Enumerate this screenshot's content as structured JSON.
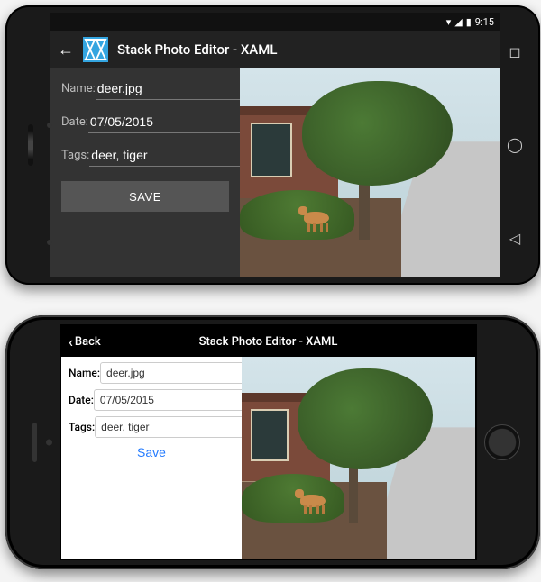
{
  "android": {
    "status": {
      "time": "9:15",
      "icons": [
        "wifi-icon",
        "signal-icon",
        "battery-icon"
      ]
    },
    "title": "Stack Photo Editor - XAML",
    "back_icon": "←",
    "form": {
      "name_label": "Name:",
      "name_value": "deer.jpg",
      "date_label": "Date:",
      "date_value": "07/05/2015",
      "tags_label": "Tags:",
      "tags_value": "deer, tiger",
      "save_label": "SAVE"
    },
    "nav": {
      "recents": "◻",
      "home": "◯",
      "back": "◁"
    }
  },
  "ios": {
    "back_label": "Back",
    "title": "Stack Photo Editor - XAML",
    "form": {
      "name_label": "Name:",
      "name_value": "deer.jpg",
      "date_label": "Date:",
      "date_value": "07/05/2015",
      "tags_label": "Tags:",
      "tags_value": "deer, tiger",
      "save_label": "Save"
    }
  },
  "photo": {
    "description": "Outdoor scene with brick building, green tree, shrubs, mulch bed, sidewalk, and a deer",
    "subject": "deer"
  }
}
